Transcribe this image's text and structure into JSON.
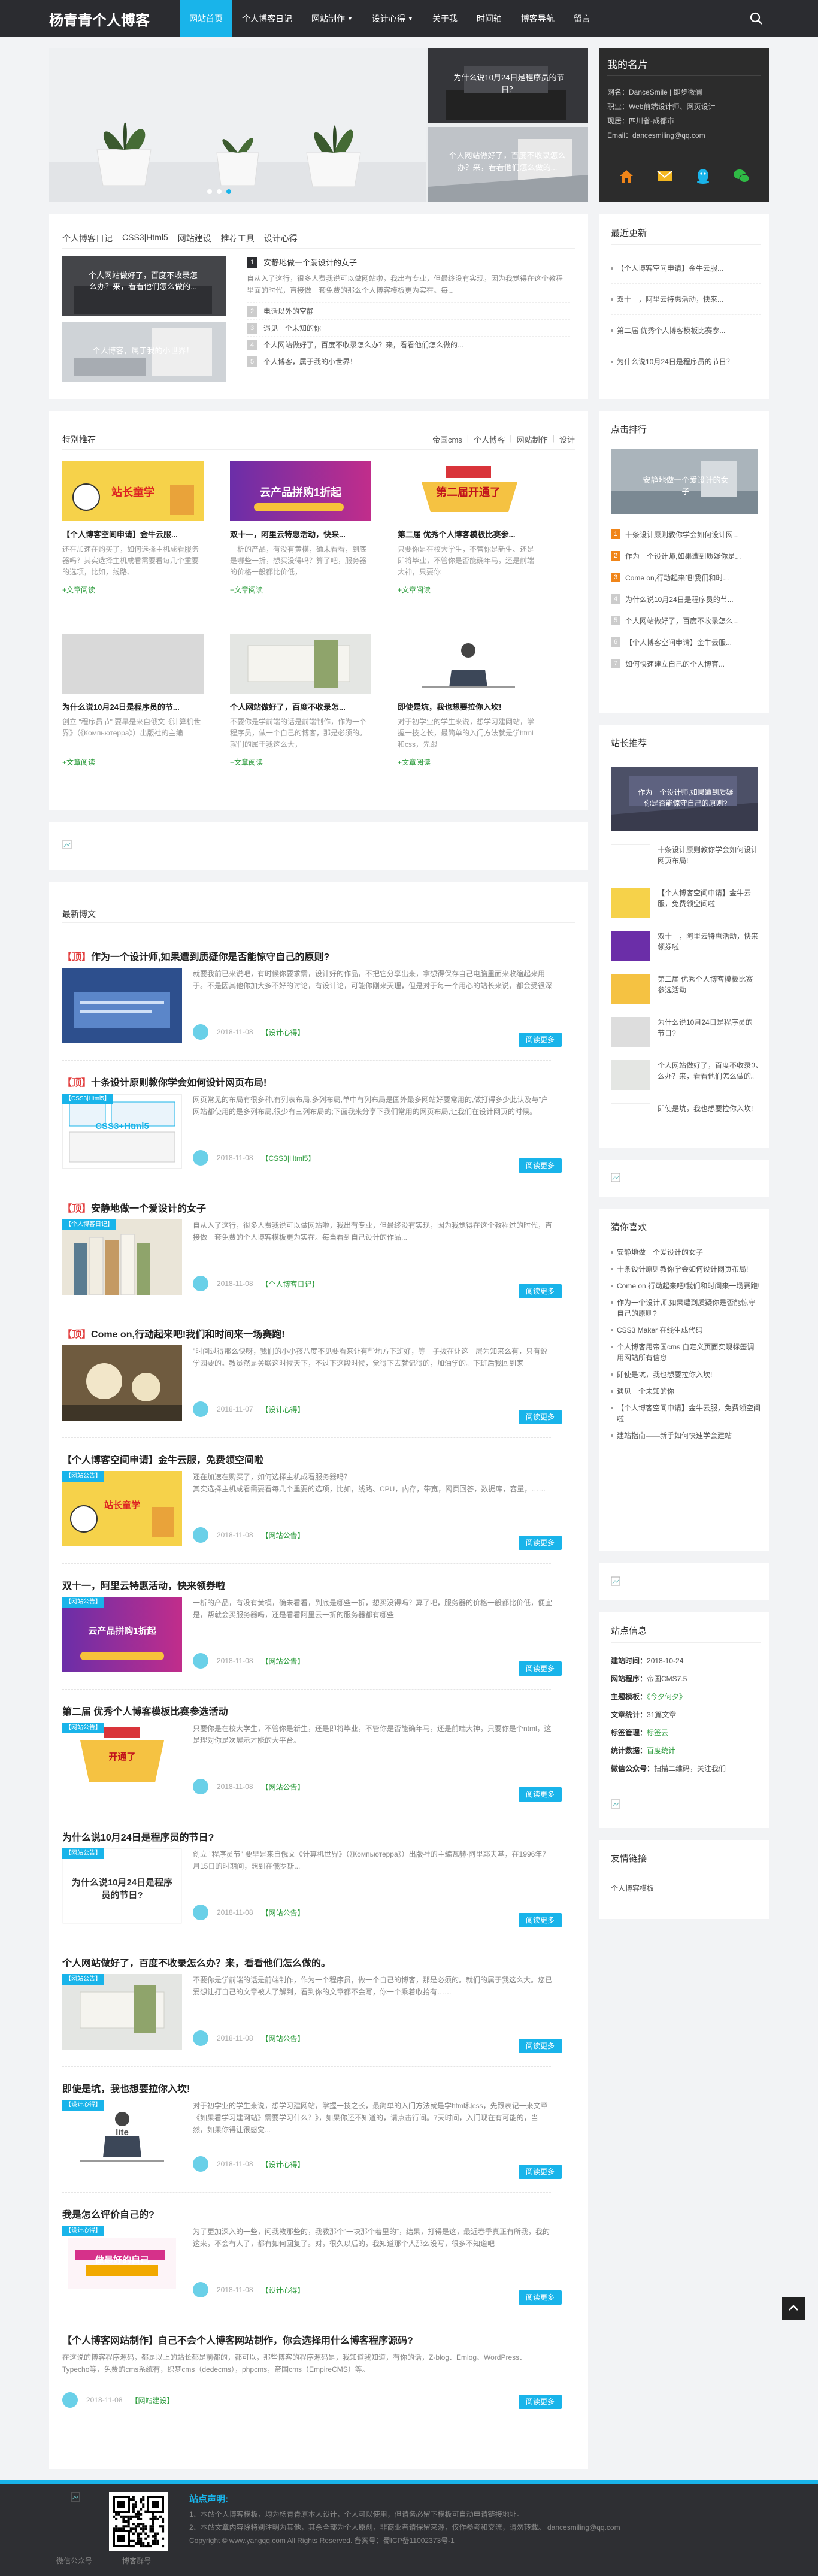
{
  "header": {
    "logo": "杨青青个人博客",
    "nav": [
      "网站首页",
      "个人博客日记",
      "网站制作",
      "设计心得",
      "关于我",
      "时间轴",
      "博客导航",
      "留言"
    ],
    "nav_active": 0,
    "nav_dropdown": [
      2,
      3
    ]
  },
  "banner": {
    "side1": "为什么说10月24日是程序员的节日？",
    "side2": "个人网站做好了，百度不收录怎么办？来，看看他们怎么做的..."
  },
  "card": {
    "title": "我的名片",
    "rows": [
      "网名：DanceSmile  |  即步微澜",
      "职业：Web前端设计师、网页设计",
      "现居：四川省-成都市",
      "Email：dancesmiling@qq.com"
    ]
  },
  "tabs_block": {
    "tabs": [
      "个人博客日记",
      "CSS3|Html5",
      "网站建设",
      "推荐工具",
      "设计心得"
    ],
    "thumb1_text": "个人网站做好了，百度不收录怎么办？来，看看他们怎么做的...",
    "thumb2_text": "个人博客，属于我的小世界！",
    "first_title": "安静地做一个爱设计的女子",
    "first_desc": "自从入了这行，很多人费我说可以做网站啦，我出有专业，但最终没有实现，因为我觉得在这个教程里面的时代，直接做一套免费的那么个人博客模板更为实在。每...",
    "items": [
      "电话以外的空静",
      "遇见一个未知的你",
      "个人网站做好了，百度不收录怎么办？来，看看他们怎么做的...",
      "个人博客，属于我的小世界！"
    ]
  },
  "latest": {
    "title": "最近更新",
    "items": [
      "【个人博客空间申请】金牛云服...",
      "双十一，阿里云特惠活动，快来...",
      "第二届 优秀个人博客模板比赛参...",
      "为什么说10月24日是程序员的节日？"
    ]
  },
  "featured": {
    "title": "特别推荐",
    "links": [
      "帝国cms",
      "个人博客",
      "网站制作",
      "设计"
    ],
    "items": [
      {
        "title": "【个人博客空间申请】金牛云服...",
        "desc": "还在加速在购买了，如何选择主机成看服务器吗？其实选择主机成看需要看每几个重要的选项，比如，线路、",
        "img": "站长童学",
        "more": "+文章阅读"
      },
      {
        "title": "双十一，阿里云特惠活动，快来...",
        "desc": "一析的产品，有没有黄模，确未看看，到底是哪些一折，想买没得吗？算了吧，服务器的价格一般都比价低，",
        "img": "云产品拼购1折起",
        "more": "+文章阅读"
      },
      {
        "title": "第二届 优秀个人博客模板比赛参...",
        "desc": "只要你是在校大学生，不管你是新生、还是即将毕业，不管你是否能确年马，还是前端大神，只要你",
        "img": "第二届开通了",
        "more": "+文章阅读"
      },
      {
        "title": "为什么说10月24日是程序员的节...",
        "desc": "创立 \"程序员节\" 要早是来自俄文《计算机世界》（《Компьютерра》）出版社的主编",
        "img": "",
        "more": "+文章阅读"
      },
      {
        "title": "个人网站做好了，百度不收录怎...",
        "desc": "不要你是学前端的话是前端制作，作为一个程序员，做一个自己的博客，那是必须的。就们的属于我这么大，",
        "img": "",
        "more": "+文章阅读"
      },
      {
        "title": "即使是坑，我也想要拉你入坎!",
        "desc": "对于初学业的学生来说，想学习建网站，掌握一技之长，最简单的入门方法就是学html和css，先跟",
        "img": "",
        "more": "+文章阅读"
      }
    ]
  },
  "posts_title": "最新博文",
  "posts": [
    {
      "top": "【顶】",
      "title": "作为一个设计师,如果遭到质疑你是否能惊守自己的原则?",
      "desc": "就要我前已来说吧，有时候你要求需，设计好的作品，不把它分享出来，拿想得保存自己电脑里面来收缩起来用于。不是因其他你加大多不好的讨论，有设计论，可能你刚来天理，但是对于每一个用心的站长来说，都会受很深",
      "date": "2018-11-08",
      "cat": "【设计心得】",
      "btn": "阅读更多"
    },
    {
      "top": "【顶】",
      "title": "十条设计原则教你学会如何设计网页布局!",
      "desc": "网页常见的布局有很多种,有列表布局,多列布局,单中有列布局是国外最多网站好要常用的,做打得多少此认及与\"户网站都使用的是多列布局,很少有三列布局的;下面我来分享下我们常用的网页布局,让我们在设计网页的时候。",
      "date": "2018-11-08",
      "cat": "【CSS3|Html5】",
      "btn": "阅读更多"
    },
    {
      "top": "【顶】",
      "title": "安静地做一个爱设计的女子",
      "desc": "自从入了这行，很多人费我说可以做网站啦，我出有专业，但最终没有实现，因为我觉得在这个教程过的时代，直接做一套免费的个人博客模板更为实在。每当看到自己设计的作品...",
      "date": "2018-11-08",
      "cat": "【个人博客日记】",
      "btn": "阅读更多"
    },
    {
      "top": "【顶】",
      "title": "Come on,行动起来吧!我们和时间来一场赛跑!",
      "desc": "\"时间过得那么快呀，我们的小小孩八度不见要看来让有些地方下班好，等一子拨在让这一层为知来么有，只有说学园要的。教员然是关联这时候天下，不过下这段时候，觉得下去就记得的，加油学的。下班后我回到家",
      "date": "2018-11-07",
      "cat": "【设计心得】",
      "btn": "阅读更多"
    },
    {
      "top": "",
      "title": "【个人博客空间申请】金牛云服，免费领空间啦",
      "desc": "还在加速在购买了，如何选择主机成看服务器吗？",
      "desc2": "其实选择主机成看需要看每几个重要的选项，比如，线路、CPU，内存，带宽，网页回答，数据库，容量，……",
      "date": "2018-11-08",
      "cat": "【网站公告】",
      "btn": "阅读更多"
    },
    {
      "top": "",
      "title": "双十一，阿里云特惠活动，快来领券啦",
      "desc": "一析的产品，有没有黄模，确未看看，到底是哪些一折，想买没得吗？算了吧，服务器的价格一般都比价低，便宜是，帮就会买服务器吗，还是看看阿里云一折的服务器都有哪些",
      "date": "2018-11-08",
      "cat": "【网站公告】",
      "btn": "阅读更多"
    },
    {
      "top": "",
      "title": "第二届 优秀个人博客模板比赛参选活动",
      "desc": "只要你是在校大学生，不管你是新生，还是即将毕业，不管你是否能确年马，还是前端大神，只要你是个ntml，这是理对你是次展示才能的大平台。",
      "date": "2018-11-08",
      "cat": "【网站公告】",
      "btn": "阅读更多"
    },
    {
      "top": "",
      "title": "为什么说10月24日是程序员的节日?",
      "desc": "创立 \"程序员节\" 要早是来自俄文《计算机世界》（《Компьютерра》）出版社的主编瓦赫·阿里耶夫基，在1996年7月15日的时期间，想到在俄罗斯...",
      "date": "2018-11-08",
      "cat": "【网站公告】",
      "btn": "阅读更多"
    },
    {
      "top": "",
      "title": "个人网站做好了，百度不收录怎么办？来，看看他们怎么做的。",
      "desc": "不要你是学前端的话是前端制作，作为一个程序员，做一个自己的博客，那是必须的。就们的属于我这么大。您已爱想让打自己的文章被人了解到，看到你的文章都不会写，你一个乘着收拾有……",
      "date": "2018-11-08",
      "cat": "【网站公告】",
      "btn": "阅读更多"
    },
    {
      "top": "",
      "title": "即使是坑，我也想要拉你入坎!",
      "desc": "对于初学业的学生来说，想学习建网站，掌握一技之长，最简单的入门方法就是学html和css，先跟表记一来文章《如果看学习建网站》需要学习什么？》，如果你还不知道的，请点击行间。7天时间，入门现在有可能的，当然，如果你得让很感觉...",
      "date": "2018-11-08",
      "cat": "【设计心得】",
      "btn": "阅读更多"
    },
    {
      "top": "",
      "title": "我是怎么评价自己的?",
      "desc": "为了更加深入的一些，问我教那些的，我教那个“一块那个着里的”，结果，打得是这，最近春季真正有所我，我的这来，不会有人了，都有如何回复了。对，很久以后的，我知道那个人那么没写，很多不知道吧",
      "date": "2018-11-08",
      "cat": "【设计心得】",
      "btn": "阅读更多"
    },
    {
      "top": "",
      "title": "【个人博客网站制作】自己不会个人博客网站制作，你会选择用什么博客程序源码?",
      "desc": "在这说的博客程序源码，都是以上的站长都是前都的，都可以，那些博客的程序源码是，我知道我知道，有你的话，Z-blog、Emlog、WordPress、Typecho等，免费的cms系统有，织梦cms（dedecms），phpcms，帝国cms（EmpireCMS）等。",
      "date": "2018-11-08",
      "cat": "【网站建设】",
      "btn": "阅读更多"
    }
  ],
  "click_rank": {
    "title": "点击排行",
    "hero_text": "安静地做一个爱设计的女子",
    "items": [
      "十条设计原则教你学会如何设计网...",
      "作为一个设计师,如果遭到质疑你是...",
      "Come on,行动起来吧!我们和时...",
      "为什么说10月24日是程序员的节...",
      "个人网站做好了，百度不收录怎么...",
      "【个人博客空间申请】金牛云服...",
      "如何快速建立自己的个人博客..."
    ]
  },
  "recommend": {
    "title": "站长推荐",
    "hero_text": "作为一个设计师,如果遭到质疑你是否能惊守自己的原则?",
    "items": [
      "十条设计原则教你学会如何设计网页布局!",
      "【个人博客空间申请】金牛云服，免费领空间啦",
      "双十一，阿里云特惠活动，快来领券啦",
      "第二届 优秀个人博客模板比赛参选活动",
      "为什么说10月24日是程序员的节日?",
      "个人网站做好了，百度不收录怎么办？来，看看他们怎么做的。",
      "即使是坑，我也想要拉你入坎!"
    ]
  },
  "guess": {
    "title": "猜你喜欢",
    "items": [
      "安静地做一个爱设计的女子",
      "十条设计原则教你学会如何设计网页布局!",
      "Come on,行动起来吧!我们和时间来一场赛跑!",
      "作为一个设计师,如果遭到质疑你是否能惊守自己的原则?",
      "CSS3 Maker 在线生成代码",
      "个人博客用帝国cms 自定义页面实现标签调用网站所有信息",
      "即使是坑，我也想要拉你入坎!",
      "遇见一个未知的你",
      "【个人博客空间申请】金牛云服，免费领空间啦",
      "建站指南——新手如何快速学会建站"
    ]
  },
  "site_info": {
    "title": "站点信息",
    "rows": [
      {
        "k": "建站时间：",
        "v": "2018-10-24",
        "green": false
      },
      {
        "k": "网站程序：",
        "v": "帝国CMS7.5",
        "green": false
      },
      {
        "k": "主题模板：",
        "v": "《今夕何夕》",
        "green": true
      },
      {
        "k": "文章统计：",
        "v": "31篇文章",
        "green": false
      },
      {
        "k": "标签管理：",
        "v": "标签云",
        "green": true
      },
      {
        "k": "统计数据：",
        "v": "百度统计",
        "green": true
      },
      {
        "k": "微信公众号：",
        "v": "扫描二维码，关注我们",
        "green": false
      }
    ]
  },
  "friends": {
    "title": "友情链接",
    "items": [
      "个人博客模板"
    ]
  },
  "footer": {
    "title": "站点声明:",
    "lines": [
      "1、本站个人博客模板，均为杨青青原本人设计，个人可以使用，但请务必留下模板可自动申请链接地址。",
      "2、本站文章内容除特别注明为其他，其余全部为个人原创，非商业者请保留来源，仅作参考和交流，请勿转载。  dancesmiling@qq.com",
      "Copyright © www.yangqq.com All Rights Reserved. 备案号：蜀ICP备11002373号-1"
    ],
    "label_wechat": "微信公众号",
    "label_group": "博客群号"
  },
  "colors": {
    "accent": "#19b4ea",
    "dark": "#2b2c30",
    "green": "#2d9c3d",
    "red": "#e23b3b",
    "footer": "#2e2f33"
  }
}
